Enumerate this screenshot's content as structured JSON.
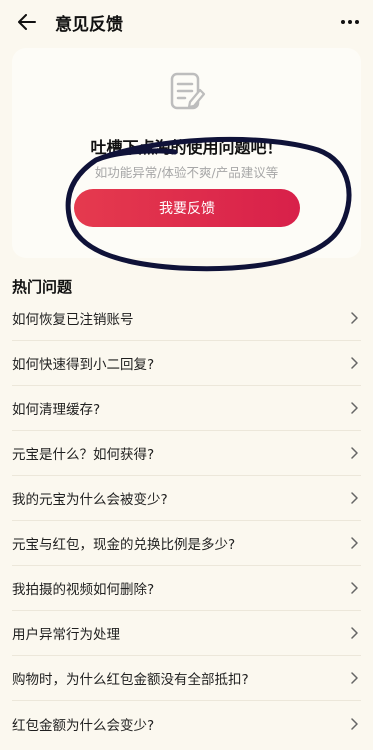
{
  "header": {
    "title": "意见反馈",
    "back_icon": "back-arrow-icon",
    "more_icon": "more-dots-icon"
  },
  "card": {
    "icon": "feedback-document-icon",
    "title": "吐槽下点淘的使用问题吧！",
    "subtitle": "如功能异常/体验不爽/产品建议等",
    "button_label": "我要反馈",
    "button_color": "#e0304b"
  },
  "faq": {
    "title": "热门问题",
    "items": [
      {
        "label": "如何恢复已注销账号"
      },
      {
        "label": "如何快速得到小二回复?"
      },
      {
        "label": "如何清理缓存?"
      },
      {
        "label": "元宝是什么？如何获得?"
      },
      {
        "label": "我的元宝为什么会被变少?"
      },
      {
        "label": "元宝与红包，现金的兑换比例是多少?"
      },
      {
        "label": "我拍摄的视频如何删除?"
      },
      {
        "label": "用户异常行为处理"
      },
      {
        "label": "购物时，为什么红包金额没有全部抵扣?"
      },
      {
        "label": "红包金额为什么会变少?"
      }
    ]
  }
}
